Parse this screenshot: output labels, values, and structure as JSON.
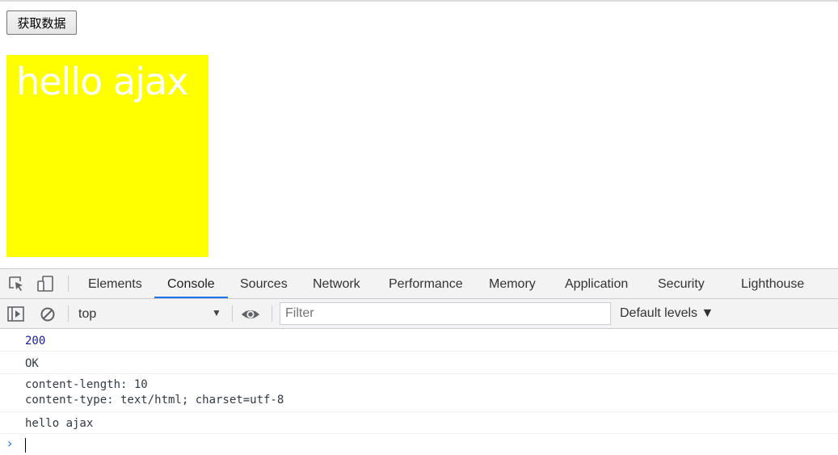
{
  "page": {
    "button_label": "获取数据",
    "box_text": "hello ajax",
    "box_color": "#ffff00"
  },
  "devtools": {
    "tabs": [
      "Elements",
      "Console",
      "Sources",
      "Network",
      "Performance",
      "Memory",
      "Application",
      "Security",
      "Lighthouse"
    ],
    "active_tab": "Console",
    "toolbar": {
      "context": "top",
      "filter_placeholder": "Filter",
      "levels": "Default levels ▼"
    },
    "console_lines": [
      {
        "text": "200",
        "type": "number"
      },
      {
        "text": "OK",
        "type": "string"
      },
      {
        "text": "content-length: 10\ncontent-type: text/html; charset=utf-8",
        "type": "string"
      },
      {
        "text": "hello ajax",
        "type": "string"
      }
    ]
  }
}
